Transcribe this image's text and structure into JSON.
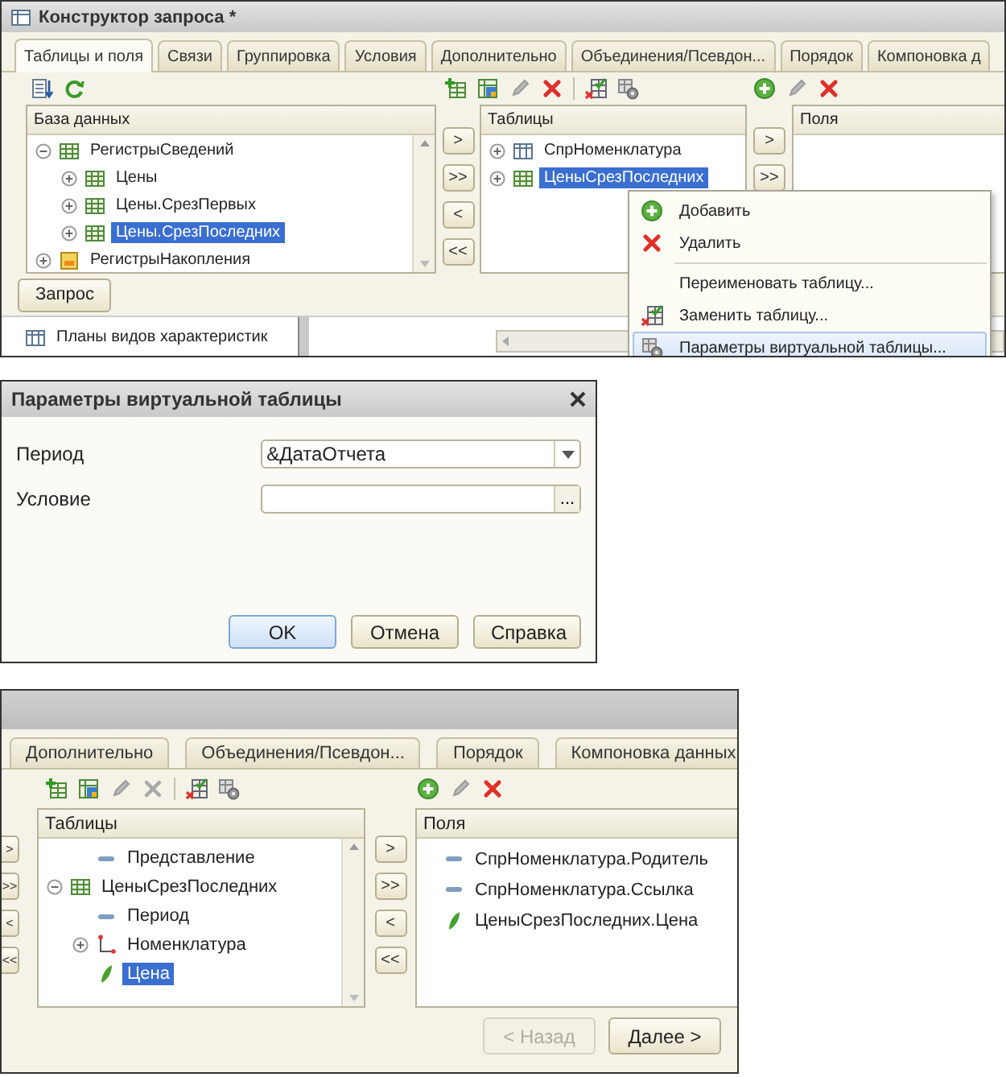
{
  "query_builder": {
    "title": "Конструктор запроса *",
    "tabs": [
      {
        "label": "Таблицы и поля",
        "selected": true
      },
      {
        "label": "Связи",
        "selected": false
      },
      {
        "label": "Группировка",
        "selected": false
      },
      {
        "label": "Условия",
        "selected": false
      },
      {
        "label": "Дополнительно",
        "selected": false
      },
      {
        "label": "Объединения/Псевдон...",
        "selected": false
      },
      {
        "label": "Порядок",
        "selected": false
      },
      {
        "label": "Компоновка д",
        "selected": false
      }
    ],
    "database": {
      "header": "База данных",
      "tree": [
        {
          "label": "РегистрыСведений",
          "kind": "table",
          "expanded": true,
          "selected": false,
          "children": [
            {
              "label": "Цены",
              "kind": "table",
              "expanded": false,
              "selected": false
            },
            {
              "label": "Цены.СрезПервых",
              "kind": "table",
              "expanded": false,
              "selected": false
            },
            {
              "label": "Цены.СрезПоследних",
              "kind": "table",
              "expanded": false,
              "selected": true
            }
          ]
        },
        {
          "label": "РегистрыНакопления",
          "kind": "register",
          "expanded": false,
          "selected": false
        }
      ]
    },
    "move_buttons": [
      ">",
      ">>",
      "<",
      "<<"
    ],
    "tables": {
      "header": "Таблицы",
      "tree": [
        {
          "label": "СпрНоменклатура",
          "kind": "catalog",
          "expanded": false,
          "selected": false
        },
        {
          "label": "ЦеныСрезПоследних",
          "kind": "table",
          "expanded": false,
          "selected": true
        }
      ]
    },
    "field_move_buttons": [
      ">",
      ">>"
    ],
    "fields": {
      "header": "Поля"
    },
    "query_button": "Запрос",
    "background_item": "Планы видов характеристик",
    "context_menu": [
      {
        "label": "Добавить",
        "kind": "add",
        "separator_before": false,
        "selected": false
      },
      {
        "label": "Удалить",
        "kind": "delete",
        "separator_before": false,
        "selected": false
      },
      {
        "label": "Переименовать таблицу...",
        "kind": "text",
        "separator_before": true,
        "selected": false
      },
      {
        "label": "Заменить таблицу...",
        "kind": "replace",
        "separator_before": false,
        "selected": false
      },
      {
        "label": "Параметры виртуальной таблицы...",
        "kind": "params",
        "separator_before": false,
        "selected": true
      }
    ]
  },
  "params_dialog": {
    "title": "Параметры виртуальной таблицы",
    "fields": [
      {
        "label": "Период",
        "kind": "dropdown",
        "value": "&ДатаОтчета"
      },
      {
        "label": "Условие",
        "kind": "text",
        "button_text": "..."
      }
    ],
    "buttons": [
      {
        "label": "OK",
        "default": true
      },
      {
        "label": "Отмена",
        "default": false
      },
      {
        "label": "Справка",
        "default": false
      }
    ]
  },
  "query_builder_step": {
    "tabs": [
      {
        "label": "Дополнительно",
        "selected": false
      },
      {
        "label": "Объединения/Псевдон...",
        "selected": false
      },
      {
        "label": "Порядок",
        "selected": false
      },
      {
        "label": "Компоновка данных",
        "selected": false
      }
    ],
    "side_buttons": [
      ">",
      ">>",
      "<",
      "<<"
    ],
    "tables": {
      "header": "Таблицы",
      "tree": [
        {
          "children": [
            {
              "label": "Представление",
              "kind": "attribute",
              "selected": false
            }
          ]
        },
        {
          "label": "ЦеныСрезПоследних",
          "kind": "table",
          "expanded": true,
          "selected": false,
          "children": [
            {
              "label": "Период",
              "kind": "attribute",
              "selected": false
            },
            {
              "label": "Номенклатура",
              "kind": "reference",
              "expanded": false,
              "selected": false
            },
            {
              "label": "Цена",
              "kind": "resource",
              "selected": true
            }
          ]
        }
      ]
    },
    "move_buttons": [
      ">",
      ">>",
      "<",
      "<<"
    ],
    "fields": {
      "header": "Поля",
      "items": [
        {
          "label": "СпрНоменклатура.Родитель",
          "kind": "attribute"
        },
        {
          "label": "СпрНоменклатура.Ссылка",
          "kind": "attribute"
        },
        {
          "label": "ЦеныСрезПоследних.Цена",
          "kind": "resource"
        }
      ]
    },
    "nav_buttons": [
      {
        "label": "< Назад",
        "disabled": true
      },
      {
        "label": "Далее >",
        "disabled": false
      }
    ]
  }
}
